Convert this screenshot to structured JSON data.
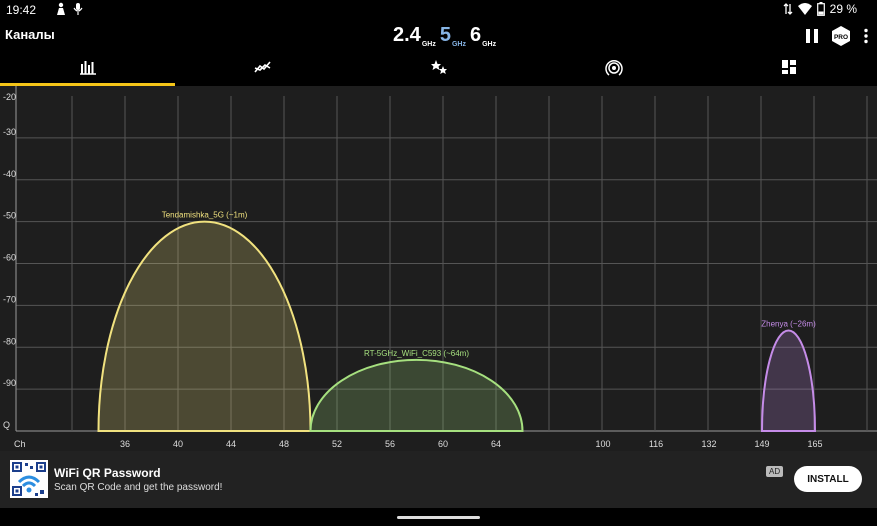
{
  "status": {
    "time": "19:42",
    "battery": "29 %",
    "icons": [
      "person-icon",
      "microphone-icon",
      "data-arrows-icon",
      "wifi-icon",
      "battery-icon"
    ]
  },
  "toolbar": {
    "title": "Каналы",
    "bands": [
      {
        "value": "2.4",
        "unit": "GHz",
        "active": false
      },
      {
        "value": "5",
        "unit": "GHz",
        "active": true
      },
      {
        "value": "6",
        "unit": "GHz",
        "active": false
      }
    ],
    "pro_label": "PRO",
    "actions": [
      "pause-icon",
      "pro-icon",
      "more-vert-icon"
    ]
  },
  "tabs": [
    {
      "icon": "channel-graph-icon",
      "active": true
    },
    {
      "icon": "time-graph-icon",
      "active": false
    },
    {
      "icon": "channel-rating-icon",
      "active": false
    },
    {
      "icon": "access-points-icon",
      "active": false
    },
    {
      "icon": "dashboard-icon",
      "active": false
    }
  ],
  "accent_color": "#f5c518",
  "chart_data": {
    "type": "area",
    "y_ticks": [
      "-20",
      "-30",
      "-40",
      "-50",
      "-60",
      "-70",
      "-80",
      "-90",
      "Q"
    ],
    "ylim": [
      -100,
      -20
    ],
    "xlabel": "Ch",
    "x_ticks": [
      "36",
      "40",
      "44",
      "48",
      "52",
      "56",
      "60",
      "64",
      "100",
      "116",
      "132",
      "149",
      "165"
    ],
    "grid": true,
    "series": [
      {
        "name": "Tendamishka_5G (~1m)",
        "center_channel": "42",
        "width_mhz": 80,
        "peak_dbm": -50,
        "color": "#f1e27f"
      },
      {
        "name": "RT-5GHz_WiFi_C593 (~64m)",
        "center_channel": "58",
        "width_mhz": 80,
        "peak_dbm": -83,
        "color": "#a6e07f"
      },
      {
        "name": "Zhenya (~26m)",
        "center_channel": "151",
        "width_mhz": 20,
        "peak_dbm": -76,
        "color": "#c58ce8"
      }
    ]
  },
  "ad": {
    "title": "WiFi QR Password",
    "description": "Scan QR Code and get the password!",
    "badge": "AD",
    "install_label": "INSTALL"
  }
}
